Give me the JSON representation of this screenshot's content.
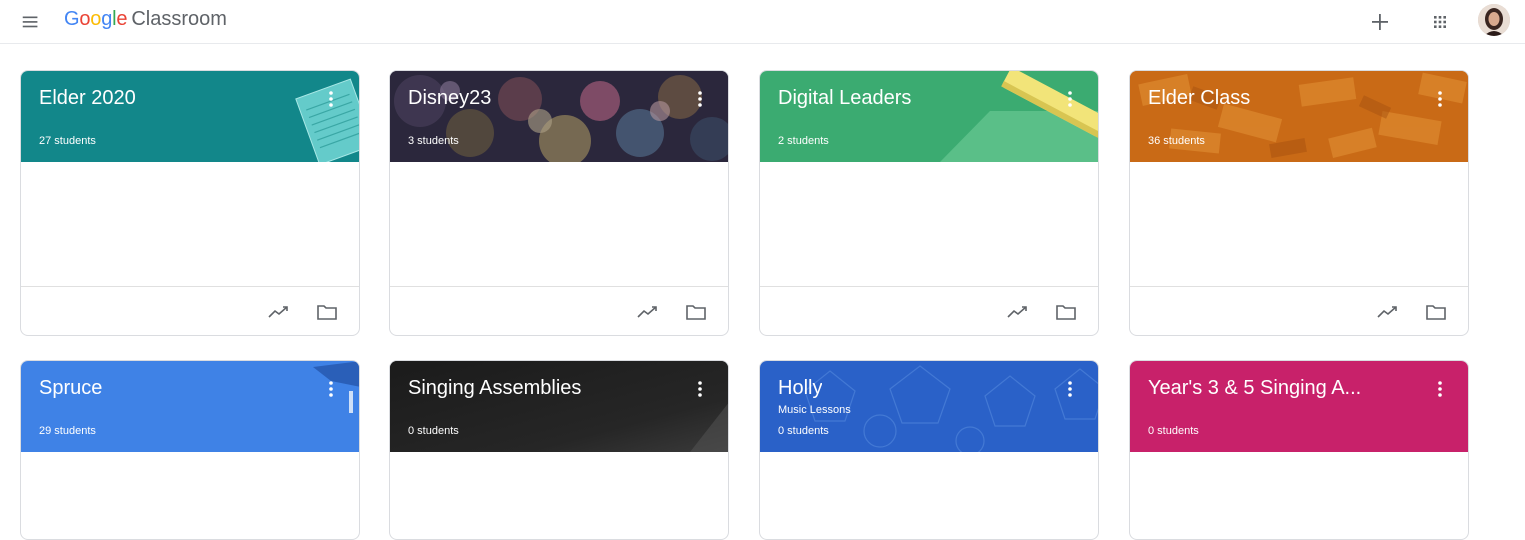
{
  "header": {
    "logo_google": "Google",
    "logo_product": "Classroom",
    "icons": [
      "menu-icon",
      "add-icon",
      "apps-icon",
      "avatar"
    ]
  },
  "colors": {
    "teal": "#12878a",
    "dark_movie": "#2c2a3a",
    "green": "#3bab71",
    "orange": "#c96a16",
    "blue": "#3f82e6",
    "black": "#1f1f1f",
    "deep_blue": "#2a61c8",
    "magenta": "#c8216a"
  },
  "classes": [
    {
      "title": "Elder 2020",
      "section": "",
      "students": "27 students",
      "footer_icons": [
        "trending-icon",
        "folder-icon"
      ]
    },
    {
      "title": "Disney23",
      "section": "",
      "students": "3 students",
      "footer_icons": [
        "trending-icon",
        "folder-icon"
      ]
    },
    {
      "title": "Digital Leaders",
      "section": "",
      "students": "2 students",
      "footer_icons": [
        "trending-icon",
        "folder-icon"
      ]
    },
    {
      "title": "Elder Class",
      "section": "",
      "students": "36 students",
      "footer_icons": [
        "trending-icon",
        "folder-icon"
      ]
    },
    {
      "title": "Spruce",
      "section": "",
      "students": "29 students"
    },
    {
      "title": "Singing Assemblies",
      "section": "",
      "students": "0 students"
    },
    {
      "title": "Holly",
      "section": "Music Lessons",
      "students": "0 students"
    },
    {
      "title": "Year's 3 & 5 Singing A...",
      "section": "",
      "students": "0 students"
    }
  ]
}
